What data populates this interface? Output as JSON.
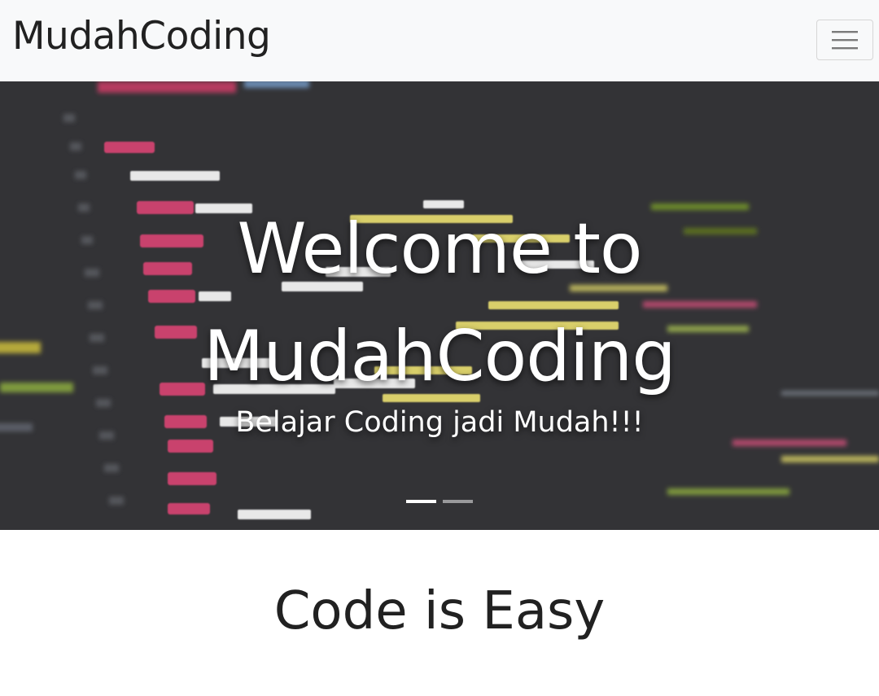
{
  "navbar": {
    "brand": "MudahCoding",
    "toggler_icon": "hamburger-menu-icon",
    "background": "#f8f9fa"
  },
  "hero": {
    "title": "Welcome to MudahCoding",
    "subtitle": "Belajar Coding jadi Mudah!!!",
    "background_image": "dark-code-editor-photo",
    "slides": 2,
    "active_slide": 1
  },
  "section": {
    "title": "Code is Easy"
  }
}
